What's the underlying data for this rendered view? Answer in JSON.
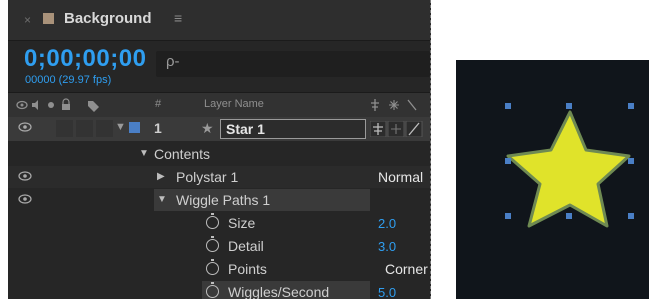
{
  "panel": {
    "tab": {
      "close": "×",
      "title": "Background",
      "menu": "≡"
    },
    "timecode": "0;00;00;00",
    "frame_info": "00000 (29.97 fps)",
    "search_icon": "ρ-",
    "headers": {
      "layer_name": "Layer Name",
      "num": "#",
      "switches": ""
    }
  },
  "layers": {
    "star": {
      "num": "1",
      "star": "★",
      "name": "Star 1"
    },
    "contents": "Contents",
    "polystar": {
      "name": "Polystar 1",
      "mode": "Normal"
    },
    "wiggle": {
      "name": "Wiggle Paths 1"
    },
    "props": [
      {
        "label": "Size",
        "value": "2.0"
      },
      {
        "label": "Detail",
        "value": "3.0"
      },
      {
        "label": "Points",
        "value": "Corner"
      },
      {
        "label": "Wiggles/Second",
        "value": "5.0"
      }
    ]
  },
  "colors": {
    "accent": "#2f9ef0",
    "panel": "#262626",
    "star_fill": "#e0e32a",
    "handle": "#4a7fc6"
  }
}
